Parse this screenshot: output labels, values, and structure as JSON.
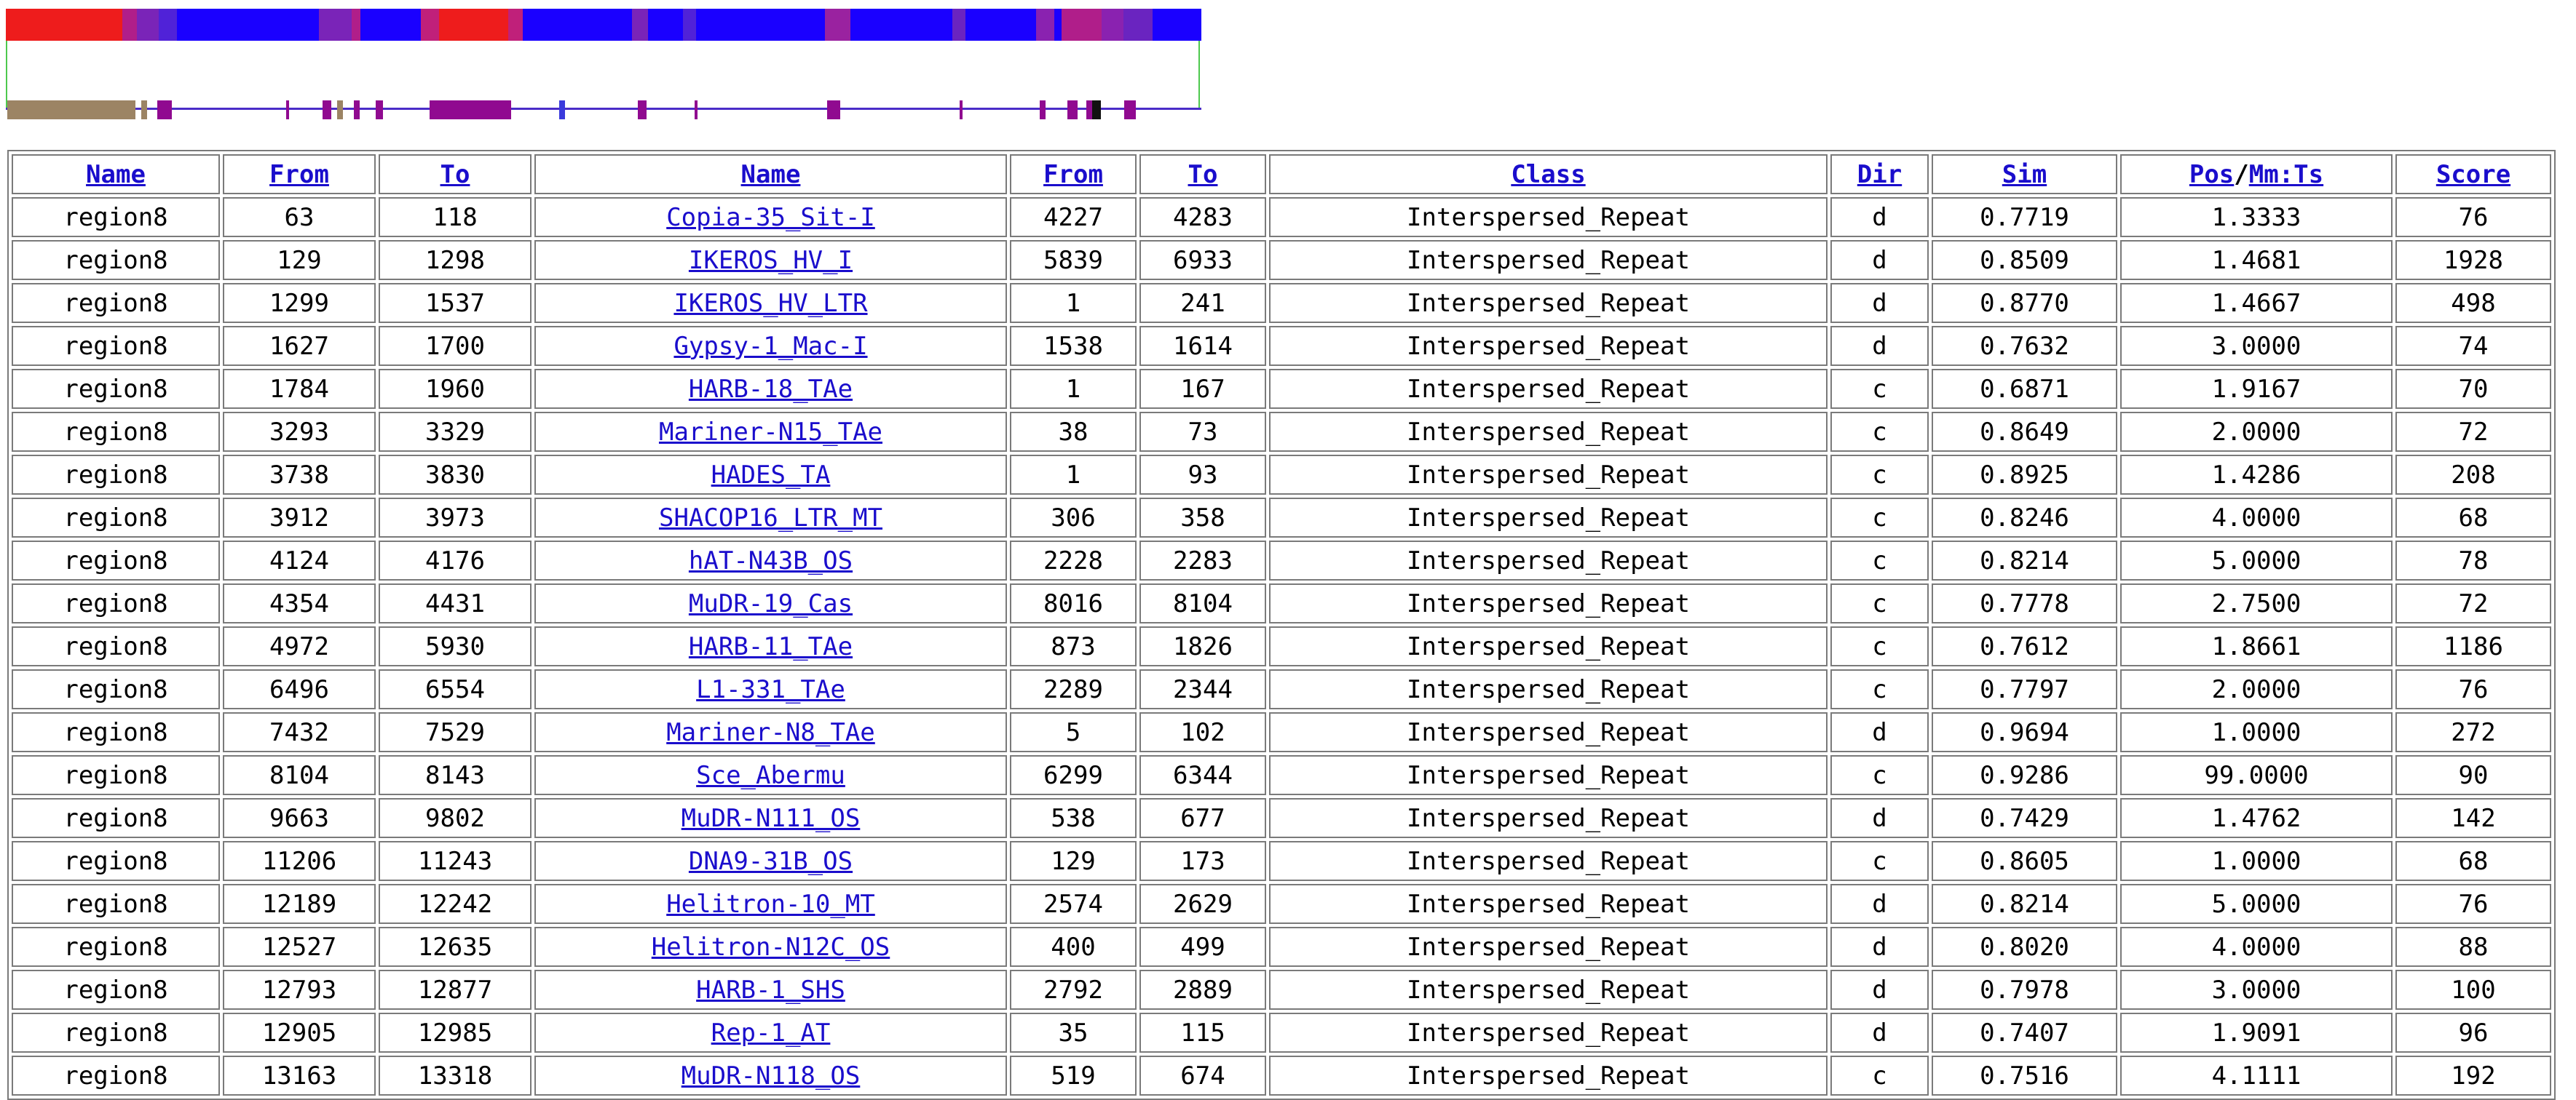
{
  "colors": {
    "band_high": "#ee1c1c",
    "band_low": "#1a00ff",
    "frame": "#4ec94e",
    "track": "#4a2cc8",
    "link": "#1a0dcc"
  },
  "headers": [
    {
      "label": "Name",
      "link": true
    },
    {
      "label": "From",
      "link": true
    },
    {
      "label": "To",
      "link": true
    },
    {
      "label": "Name",
      "link": true
    },
    {
      "label": "From",
      "link": true
    },
    {
      "label": "To",
      "link": true
    },
    {
      "label": "Class",
      "link": true
    },
    {
      "label": "Dir",
      "link": true
    },
    {
      "label": "Sim",
      "link": true
    },
    {
      "label_parts": [
        "Pos",
        "/",
        "Mm:Ts"
      ],
      "link": true
    },
    {
      "label": "Score",
      "link": true
    }
  ],
  "rows": [
    [
      "region8",
      "63",
      "118",
      "Copia-35_Sit-I",
      "4227",
      "4283",
      "Interspersed_Repeat",
      "d",
      "0.7719",
      "1.3333",
      "76"
    ],
    [
      "region8",
      "129",
      "1298",
      "IKEROS_HV_I",
      "5839",
      "6933",
      "Interspersed_Repeat",
      "d",
      "0.8509",
      "1.4681",
      "1928"
    ],
    [
      "region8",
      "1299",
      "1537",
      "IKEROS_HV_LTR",
      "1",
      "241",
      "Interspersed_Repeat",
      "d",
      "0.8770",
      "1.4667",
      "498"
    ],
    [
      "region8",
      "1627",
      "1700",
      "Gypsy-1_Mac-I",
      "1538",
      "1614",
      "Interspersed_Repeat",
      "d",
      "0.7632",
      "3.0000",
      "74"
    ],
    [
      "region8",
      "1784",
      "1960",
      "HARB-18_TAe",
      "1",
      "167",
      "Interspersed_Repeat",
      "c",
      "0.6871",
      "1.9167",
      "70"
    ],
    [
      "region8",
      "3293",
      "3329",
      "Mariner-N15_TAe",
      "38",
      "73",
      "Interspersed_Repeat",
      "c",
      "0.8649",
      "2.0000",
      "72"
    ],
    [
      "region8",
      "3738",
      "3830",
      "HADES_TA",
      "1",
      "93",
      "Interspersed_Repeat",
      "c",
      "0.8925",
      "1.4286",
      "208"
    ],
    [
      "region8",
      "3912",
      "3973",
      "SHACOP16_LTR_MT",
      "306",
      "358",
      "Interspersed_Repeat",
      "c",
      "0.8246",
      "4.0000",
      "68"
    ],
    [
      "region8",
      "4124",
      "4176",
      "hAT-N43B_OS",
      "2228",
      "2283",
      "Interspersed_Repeat",
      "c",
      "0.8214",
      "5.0000",
      "78"
    ],
    [
      "region8",
      "4354",
      "4431",
      "MuDR-19_Cas",
      "8016",
      "8104",
      "Interspersed_Repeat",
      "c",
      "0.7778",
      "2.7500",
      "72"
    ],
    [
      "region8",
      "4972",
      "5930",
      "HARB-11_TAe",
      "873",
      "1826",
      "Interspersed_Repeat",
      "c",
      "0.7612",
      "1.8661",
      "1186"
    ],
    [
      "region8",
      "6496",
      "6554",
      "L1-331_TAe",
      "2289",
      "2344",
      "Interspersed_Repeat",
      "c",
      "0.7797",
      "2.0000",
      "76"
    ],
    [
      "region8",
      "7432",
      "7529",
      "Mariner-N8_TAe",
      "5",
      "102",
      "Interspersed_Repeat",
      "d",
      "0.9694",
      "1.0000",
      "272"
    ],
    [
      "region8",
      "8104",
      "8143",
      "Sce_Abermu",
      "6299",
      "6344",
      "Interspersed_Repeat",
      "c",
      "0.9286",
      "99.0000",
      "90"
    ],
    [
      "region8",
      "9663",
      "9802",
      "MuDR-N111_OS",
      "538",
      "677",
      "Interspersed_Repeat",
      "d",
      "0.7429",
      "1.4762",
      "142"
    ],
    [
      "region8",
      "11206",
      "11243",
      "DNA9-31B_OS",
      "129",
      "173",
      "Interspersed_Repeat",
      "c",
      "0.8605",
      "1.0000",
      "68"
    ],
    [
      "region8",
      "12189",
      "12242",
      "Helitron-10_MT",
      "2574",
      "2629",
      "Interspersed_Repeat",
      "d",
      "0.8214",
      "5.0000",
      "76"
    ],
    [
      "region8",
      "12527",
      "12635",
      "Helitron-N12C_OS",
      "400",
      "499",
      "Interspersed_Repeat",
      "d",
      "0.8020",
      "4.0000",
      "88"
    ],
    [
      "region8",
      "12793",
      "12877",
      "HARB-1_SHS",
      "2792",
      "2889",
      "Interspersed_Repeat",
      "d",
      "0.7978",
      "3.0000",
      "100"
    ],
    [
      "region8",
      "12905",
      "12985",
      "Rep-1_AT",
      "35",
      "115",
      "Interspersed_Repeat",
      "d",
      "0.7407",
      "1.9091",
      "96"
    ],
    [
      "region8",
      "13163",
      "13318",
      "MuDR-N118_OS",
      "519",
      "674",
      "Interspersed_Repeat",
      "c",
      "0.7516",
      "4.1111",
      "192"
    ]
  ]
}
